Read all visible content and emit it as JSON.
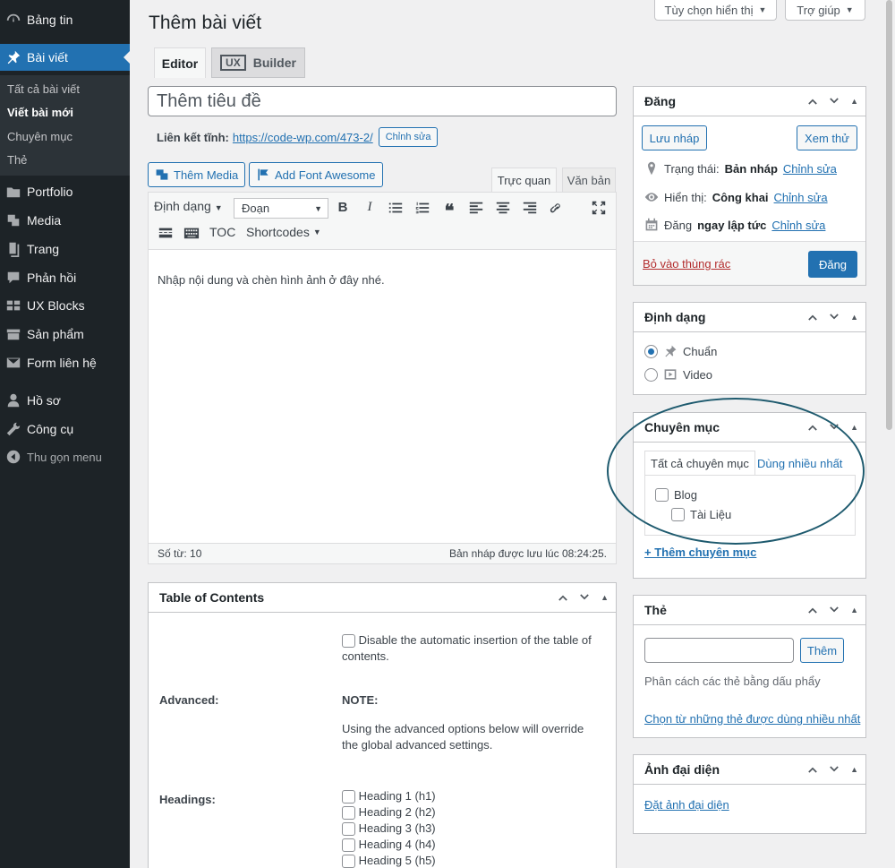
{
  "sidebar": {
    "items": [
      {
        "label": "Bảng tin",
        "icon": "dashboard-icon"
      },
      {
        "label": "Bài viết",
        "icon": "pin-icon"
      },
      {
        "label": "Portfolio",
        "icon": "portfolio-icon"
      },
      {
        "label": "Media",
        "icon": "media-icon"
      },
      {
        "label": "Trang",
        "icon": "page-icon"
      },
      {
        "label": "Phản hồi",
        "icon": "comment-icon"
      },
      {
        "label": "UX Blocks",
        "icon": "blocks-icon"
      },
      {
        "label": "Sản phẩm",
        "icon": "product-icon"
      },
      {
        "label": "Form liên hệ",
        "icon": "mail-icon"
      },
      {
        "label": "Hồ sơ",
        "icon": "user-icon"
      },
      {
        "label": "Công cụ",
        "icon": "wrench-icon"
      }
    ],
    "submenu": [
      "Tất cả bài viết",
      "Viết bài mới",
      "Chuyên mục",
      "Thẻ"
    ],
    "collapse_label": "Thu gọn menu",
    "accent": "#2271b1"
  },
  "header": {
    "title": "Thêm bài viết",
    "screen_options": "Tùy chọn hiển thị",
    "help": "Trợ giúp"
  },
  "editor_tabs": {
    "editor": "Editor",
    "ux_logo": "UX",
    "builder": "Builder"
  },
  "title_field": {
    "placeholder": "Thêm tiêu đề"
  },
  "permalink": {
    "label": "Liên kết tĩnh:",
    "url": "https://code-wp.com/473-2/",
    "edit": "Chỉnh sửa"
  },
  "media_buttons": {
    "add_media": "Thêm Media",
    "font_awesome": "Add Font Awesome"
  },
  "mode_tabs": {
    "visual": "Trực quan",
    "text": "Văn bản"
  },
  "toolbar": {
    "format": "Định dạng",
    "paragraph": "Đoạn",
    "toc": "TOC",
    "shortcodes": "Shortcodes"
  },
  "content": {
    "placeholder": "Nhập nội dung và chèn hình ảnh ở đây nhé."
  },
  "status": {
    "word_count": "Số từ: 10",
    "saved": "Bản nháp được lưu lúc 08:24:25."
  },
  "toc": {
    "title": "Table of Contents",
    "disable_label": "Disable the automatic insertion of the table of contents.",
    "advanced_label": "Advanced:",
    "note_label": "NOTE:",
    "note_text": "Using the advanced options below will override the global advanced settings.",
    "headings_label": "Headings:",
    "headings": [
      "Heading 1 (h1)",
      "Heading 2 (h2)",
      "Heading 3 (h3)",
      "Heading 4 (h4)",
      "Heading 5 (h5)"
    ]
  },
  "publish": {
    "title": "Đăng",
    "save_draft": "Lưu nháp",
    "preview": "Xem thử",
    "status_label": "Trạng thái:",
    "status_value": "Bản nháp",
    "visibility_label": "Hiển thị:",
    "visibility_value": "Công khai",
    "schedule_label": "Đăng",
    "schedule_value": "ngay lập tức",
    "edit": "Chỉnh sửa",
    "trash": "Bỏ vào thùng rác",
    "publish_btn": "Đăng"
  },
  "format_box": {
    "title": "Định dạng",
    "options": [
      "Chuẩn",
      "Video"
    ],
    "selected": "Chuẩn"
  },
  "category_box": {
    "title": "Chuyên mục",
    "tab_all": "Tất cả chuyên mục",
    "tab_popular": "Dùng nhiều nhất",
    "categories": [
      "Blog",
      "Tài Liệu"
    ],
    "add_link": "+ Thêm chuyên mục"
  },
  "tags_box": {
    "title": "Thẻ",
    "add_btn": "Thêm",
    "hint": "Phân cách các thẻ bằng dấu phẩy",
    "choose_link": "Chọn từ những thẻ được dùng nhiều nhất"
  },
  "featured_box": {
    "title": "Ảnh đại diện",
    "set_link": "Đặt ảnh đại diện"
  }
}
